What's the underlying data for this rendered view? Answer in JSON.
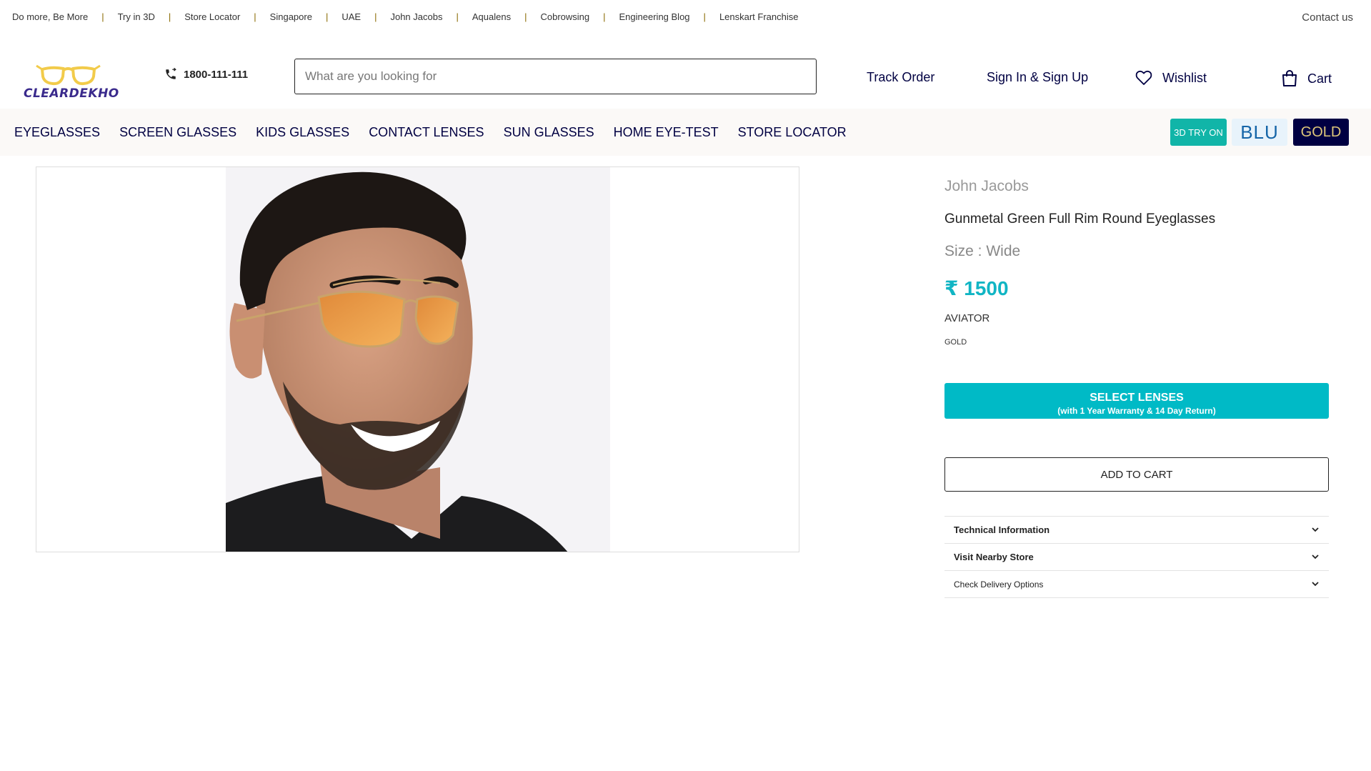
{
  "topbar": {
    "links": [
      "Do more, Be More",
      "Try in 3D",
      "Store Locator",
      "Singapore",
      "UAE",
      "John Jacobs",
      "Aqualens",
      "Cobrowsing",
      "Engineering Blog",
      "Lenskart Franchise"
    ],
    "separator": "|",
    "contact": "Contact us"
  },
  "header": {
    "logo_text": "CLEARDEKHO",
    "phone": "1800-111-111",
    "search_placeholder": "What are you looking for",
    "track_order": "Track Order",
    "sign_in": "Sign In & Sign Up",
    "wishlist": "Wishlist",
    "cart": "Cart"
  },
  "nav": {
    "items": [
      "EYEGLASSES",
      "SCREEN GLASSES",
      "KIDS GLASSES",
      "CONTACT LENSES",
      "SUN GLASSES",
      "HOME EYE-TEST",
      "STORE LOCATOR"
    ],
    "badge_3d": "3D TRY ON",
    "badge_blu": "BLU",
    "badge_gold": "GOLD"
  },
  "product": {
    "brand": "John Jacobs",
    "name": "Gunmetal Green Full Rim Round Eyeglasses",
    "size": "Size : Wide",
    "price": "₹ 1500",
    "shape": "AVIATOR",
    "color": "GOLD",
    "select_lenses": "SELECT LENSES",
    "select_lenses_sub": "(with 1 Year Warranty & 14 Day Return)",
    "add_to_cart": "ADD TO CART",
    "accordion": [
      "Technical Information",
      "Visit Nearby Store",
      "Check Delivery Options"
    ]
  },
  "colors": {
    "navy": "#000042",
    "teal": "#00bac6",
    "price": "#11b5c4",
    "logo_frame": "#f2cb4a"
  }
}
